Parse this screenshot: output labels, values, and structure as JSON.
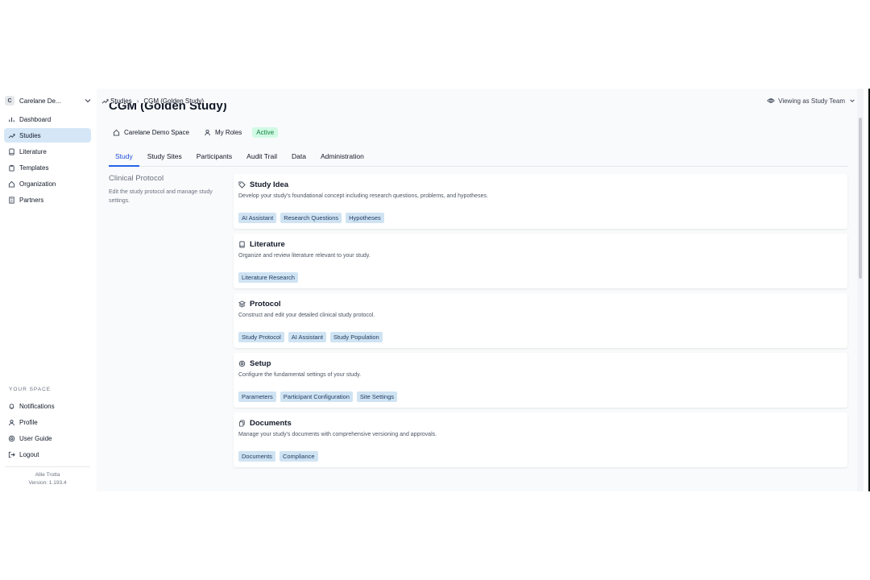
{
  "workspace": {
    "badge": "C",
    "name": "Carelane De..."
  },
  "sidebar": {
    "items": [
      {
        "label": "Dashboard",
        "icon": "chart-bar-icon"
      },
      {
        "label": "Studies",
        "icon": "trending-up-icon",
        "active": true
      },
      {
        "label": "Literature",
        "icon": "book-icon"
      },
      {
        "label": "Templates",
        "icon": "clipboard-icon"
      },
      {
        "label": "Organization",
        "icon": "home-icon"
      },
      {
        "label": "Partners",
        "icon": "building-icon"
      }
    ],
    "section_label": "YOUR SPACE",
    "space_items": [
      {
        "label": "Notifications",
        "icon": "bell-icon"
      },
      {
        "label": "Profile",
        "icon": "user-icon"
      },
      {
        "label": "User Guide",
        "icon": "lifebuoy-icon"
      },
      {
        "label": "Logout",
        "icon": "logout-icon"
      }
    ],
    "user_name": "Allie Trotta",
    "version": "Version: 1.193.4"
  },
  "breadcrumb": {
    "root": "Studies",
    "current": "CGM (Golden Study)"
  },
  "viewing": {
    "label": "Viewing as Study Team"
  },
  "page": {
    "title": "CGM (Golden Study)",
    "space": "Carelane Demo Space",
    "roles": "My Roles",
    "status": "Active"
  },
  "tabs": [
    "Study",
    "Study Sites",
    "Participants",
    "Audit Trail",
    "Data",
    "Administration"
  ],
  "active_tab": "Study",
  "section": {
    "heading": "Clinical Protocol",
    "description": "Edit the study protocol and manage study settings."
  },
  "cards": [
    {
      "title": "Study Idea",
      "icon": "tag-icon",
      "description": "Develop your study's foundational concept including research questions, problems, and hypotheses.",
      "tags": [
        "AI Assistant",
        "Research Questions",
        "Hypotheses"
      ]
    },
    {
      "title": "Literature",
      "icon": "book-icon",
      "description": "Organize and review literature relevant to your study.",
      "tags": [
        "Literature Research"
      ]
    },
    {
      "title": "Protocol",
      "icon": "layers-icon",
      "description": "Construct and edit your detailed clinical study protocol.",
      "tags": [
        "Study Protocol",
        "AI Assistant",
        "Study Population"
      ]
    },
    {
      "title": "Setup",
      "icon": "gear-icon",
      "description": "Configure the fundamental settings of your study.",
      "tags": [
        "Parameters",
        "Participant Configuration",
        "Site Settings"
      ]
    },
    {
      "title": "Documents",
      "icon": "documents-icon",
      "description": "Manage your study's documents with comprehensive versioning and approvals.",
      "tags": [
        "Documents",
        "Compliance"
      ]
    }
  ],
  "colors": {
    "active_nav": "#d5e7f6",
    "tag_bg": "#cfe3f3",
    "active_badge": "#d1fae5",
    "tab_accent": "#2563eb"
  }
}
